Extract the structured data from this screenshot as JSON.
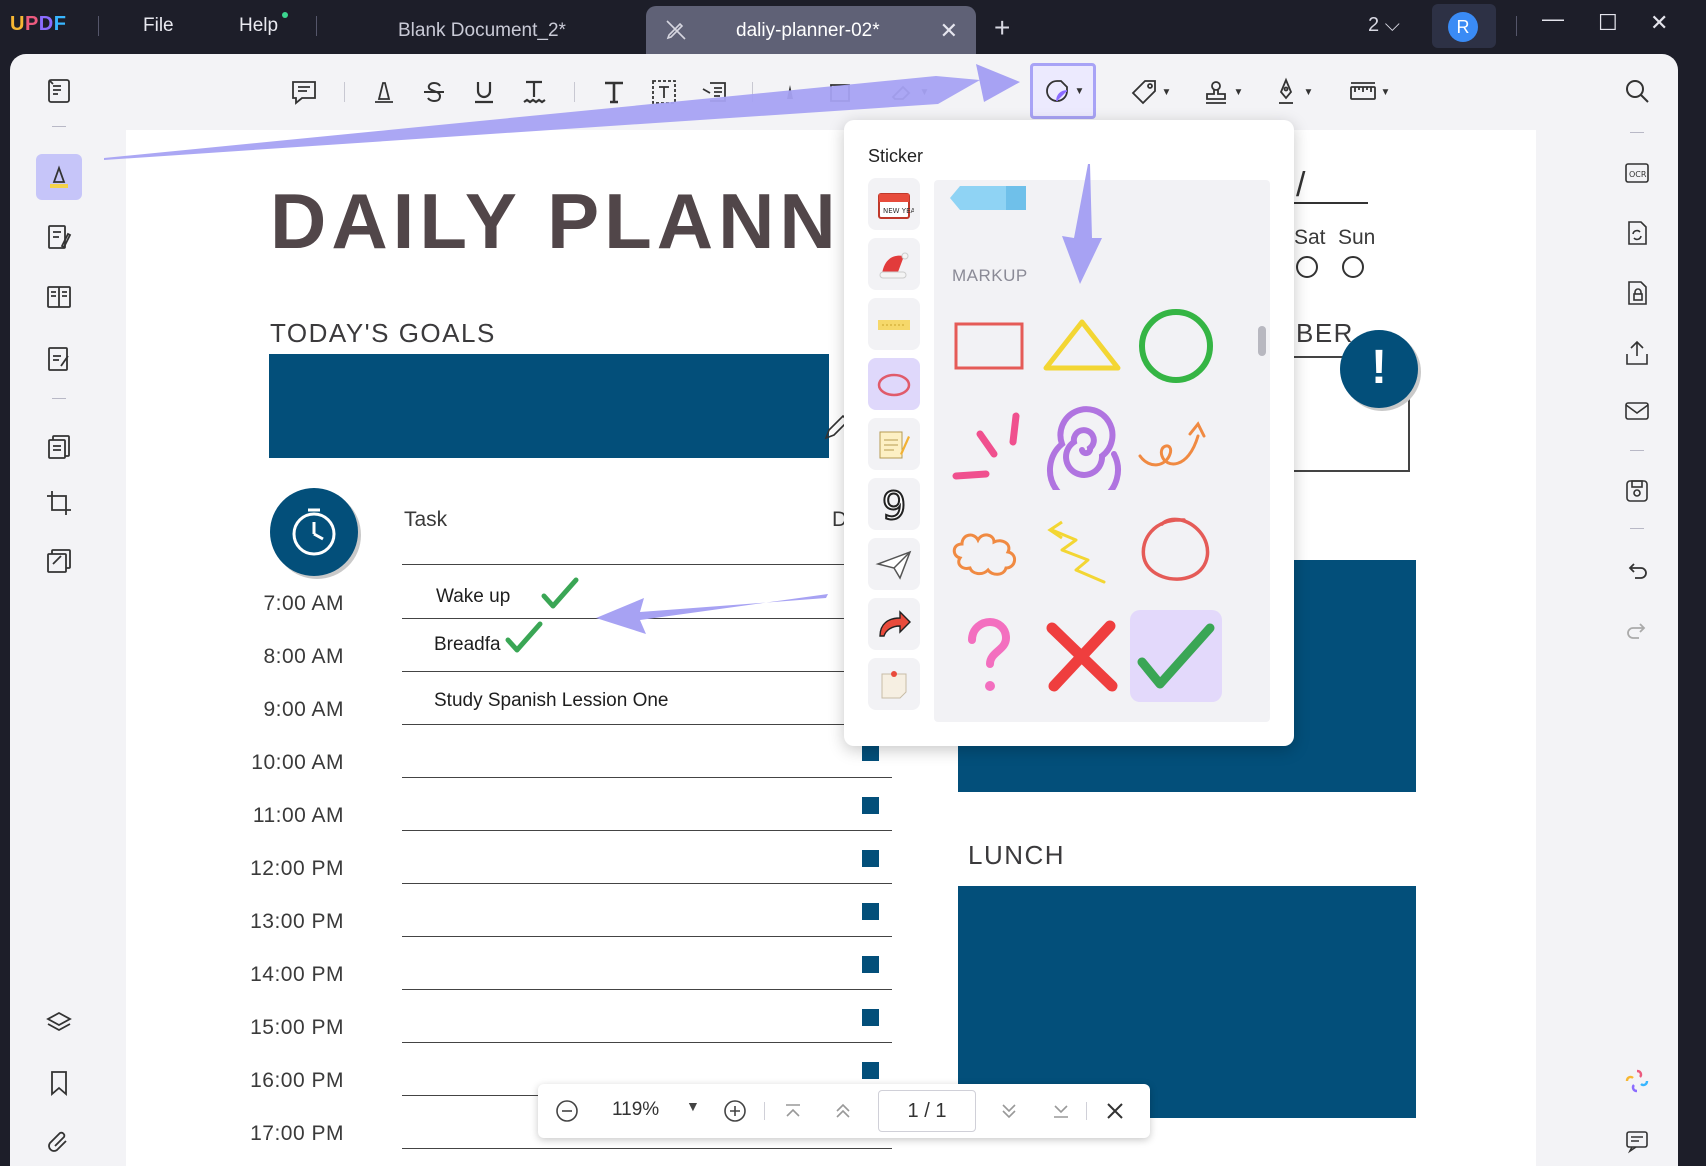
{
  "app": {
    "logo": "UPDF"
  },
  "menu": {
    "file": "File",
    "help": "Help"
  },
  "tabs": [
    {
      "label": "Blank Document_2*",
      "active": false
    },
    {
      "label": "daliy-planner-02*",
      "active": true
    }
  ],
  "titlebar": {
    "page_count": "2",
    "avatar_initial": "R"
  },
  "document": {
    "title": "DAILY PLANNE",
    "goals_label": "TODAY'S GOALS",
    "task_header": "Task",
    "d_header": "D",
    "days": [
      "Sat",
      "Sun"
    ],
    "remember_label": "BER",
    "exclaim": "!",
    "lunch_label": "LUNCH",
    "times": [
      "7:00 AM",
      "8:00 AM",
      "9:00 AM",
      "10:00 AM",
      "11:00 AM",
      "12:00 PM",
      "13:00 PM",
      "14:00 PM",
      "15:00 PM",
      "16:00 PM",
      "17:00 PM"
    ],
    "tasks": [
      "Wake up",
      "Breadfa",
      "Study Spanish Lession One"
    ]
  },
  "sticker_panel": {
    "title": "Sticker",
    "section": "MARKUP",
    "categories": [
      "new-year",
      "santa-hat",
      "tape",
      "markup",
      "notepad",
      "number",
      "paper-plane",
      "arrow",
      "memo"
    ],
    "active_category": "markup",
    "items": [
      "rectangle",
      "triangle",
      "circle-green",
      "emphasis-lines",
      "spiral",
      "curly-arrow",
      "cloud",
      "zigzag-arrow",
      "circle-red",
      "question-mark",
      "cross",
      "checkmark"
    ],
    "active_item": "checkmark"
  },
  "zoombar": {
    "zoom": "119%",
    "page": "1 / 1"
  },
  "colors": {
    "accent": "#a8a3f6",
    "navy": "#034f7a",
    "titlebar": "#1d1e29"
  }
}
